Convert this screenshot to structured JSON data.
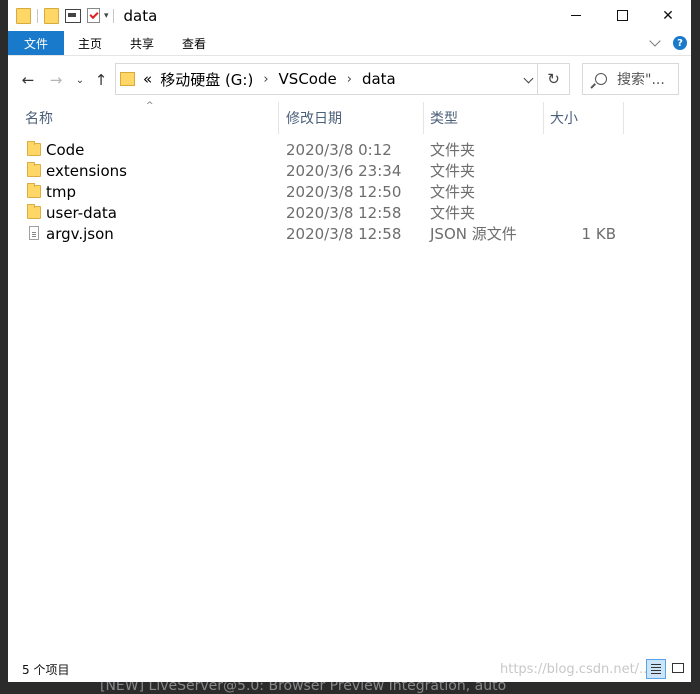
{
  "window": {
    "title": "data"
  },
  "ribbon": {
    "tabs": [
      "文件",
      "主页",
      "共享",
      "查看"
    ],
    "help": "?"
  },
  "nav": {
    "refresh": "↻",
    "breadcrumb_prefix": "«",
    "crumbs": [
      "移动硬盘 (G:)",
      "VSCode",
      "data"
    ],
    "crumb_separator": "›",
    "search_placeholder": "搜索\"..."
  },
  "columns": {
    "name": "名称",
    "date": "修改日期",
    "type": "类型",
    "size": "大小"
  },
  "files": [
    {
      "name": "Code",
      "date": "2020/3/8 0:12",
      "type": "文件夹",
      "size": "",
      "icon": "folder-icon"
    },
    {
      "name": "extensions",
      "date": "2020/3/6 23:34",
      "type": "文件夹",
      "size": "",
      "icon": "folder-icon"
    },
    {
      "name": "tmp",
      "date": "2020/3/8 12:50",
      "type": "文件夹",
      "size": "",
      "icon": "folder-icon"
    },
    {
      "name": "user-data",
      "date": "2020/3/8 12:58",
      "type": "文件夹",
      "size": "",
      "icon": "folder-icon"
    },
    {
      "name": "argv.json",
      "date": "2020/3/8 12:58",
      "type": "JSON 源文件",
      "size": "1 KB",
      "icon": "json-file-icon"
    }
  ],
  "status": {
    "item_count": "5 个项目",
    "watermark": "https://blog.csdn.net/..."
  },
  "background": {
    "taskbar_text": "[NEW] LiveServer@5.0: Browser Preview Integration, auto"
  },
  "colors": {
    "accent": "#1979ca",
    "folder": "#ffd766",
    "header_text": "#4c607a",
    "meta_text": "#6d6d6d"
  }
}
